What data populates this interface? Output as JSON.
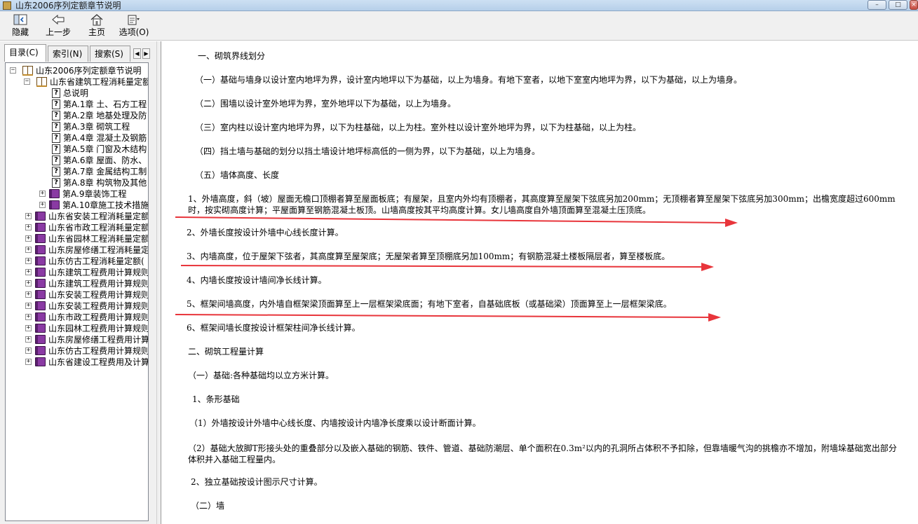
{
  "window": {
    "title": "山东2006序列定额章节说明",
    "controls": {
      "minimize": "–",
      "maximize": "□",
      "close": "×"
    }
  },
  "toolbar": {
    "hide": {
      "label": "隐藏",
      "icon": "hide-icon"
    },
    "back": {
      "label": "上一步",
      "icon": "back-arrow-icon"
    },
    "home": {
      "label": "主页",
      "icon": "home-icon"
    },
    "options": {
      "label": "选项(O)",
      "icon": "options-icon"
    }
  },
  "tabs": {
    "contents": "目录(C)",
    "index": "索引(N)",
    "search": "搜索(S)",
    "prev": "◀",
    "next": "▶"
  },
  "tree": {
    "expand_open": "−",
    "expand_closed": "+",
    "topic_glyph": "?",
    "root": "山东2006序列定额章节说明",
    "group": "山东省建筑工程消耗量定额",
    "topics": [
      "总说明",
      "第A.1章 土、石方工程",
      "第A.2章 地基处理及防",
      "第A.3章 砌筑工程",
      "第A.4章 混凝土及钢筋",
      "第A.5章 门窗及木结构",
      "第A.6章 屋面、防水、",
      "第A.7章 金属结构工制",
      "第A.8章 构筑物及其他"
    ],
    "chapters": [
      "第A.9章装饰工程",
      "第A.10章施工技术措施"
    ],
    "books": [
      "山东省安装工程消耗量定额",
      "山东省市政工程消耗量定额",
      "山东省园林工程消耗量定额",
      "山东房屋修缮工程消耗量定",
      "山东仿古工程消耗量定额(",
      "山东建筑工程费用计算规则",
      "山东建筑工程费用计算规则",
      "山东安装工程费用计算规则",
      "山东安装工程费用计算规则",
      "山东市政工程费用计算规则",
      "山东园林工程费用计算规则",
      "山东房屋修缮工程费用计算",
      "山东仿古工程费用计算规则",
      "山东省建设工程费用及计算"
    ]
  },
  "content": {
    "paragraphs": [
      "一、砌筑界线划分",
      "（一）基础与墙身以设计室内地坪为界，设计室内地坪以下为基础，以上为墙身。有地下室者，以地下室室内地坪为界，以下为基础，以上为墙身。",
      "（二）围墙以设计室外地坪为界，室外地坪以下为基础，以上为墙身。",
      "（三）室内柱以设计室内地坪为界，以下为柱基础，以上为柱。室外柱以设计室外地坪为界，以下为柱基础，以上为柱。",
      "（四）挡土墙与基础的划分以挡土墙设计地坪标高低的一侧为界，以下为基础，以上为墙身。",
      "（五）墙体高度、长度",
      "1、外墙高度，斜（坡）屋面无檐口顶棚者算至屋面板底；有屋架，且室内外均有顶棚者，其高度算至屋架下弦底另加200mm；无顶棚者算至屋架下弦底另加300mm；出檐宽度超过600mm时，按实砌高度计算；平屋面算至钢筋混凝土板顶。山墙高度按其平均高度计算。女儿墙高度自外墙顶面算至混凝土压顶底。",
      "2、外墙长度按设计外墙中心线长度计算。",
      "3、内墙高度，位于屋架下弦者，其高度算至屋架底；无屋架者算至顶棚底另加100mm；有钢筋混凝土楼板隔层者，算至楼板底。",
      "4、内墙长度按设计墙间净长线计算。",
      "5、框架间墙高度，内外墙自框架梁顶面算至上一层框架梁底面；有地下室者，自基础底板（或基础梁）顶面算至上一层框架梁底。",
      "6、框架间墙长度按设计框架柱间净长线计算。",
      "二、砌筑工程量计算",
      "（一）基础:各种基础均以立方米计算。",
      "1、条形基础",
      "（1）外墙按设计外墙中心线长度、内墙按设计内墙净长度乘以设计断面计算。",
      "（2）基础大放脚T形接头处的重叠部分以及嵌入基础的钢筋、铁件、管道、基础防潮层、单个面积在0.3m²以内的孔洞所占体积不予扣除，但靠墙暖气沟的挑檐亦不增加，附墙垛基础宽出部分体积并入基础工程量内。",
      "2、独立基础按设计图示尺寸计算。",
      "（二）墙"
    ],
    "annotation_arrow_color": "#e8353b"
  }
}
